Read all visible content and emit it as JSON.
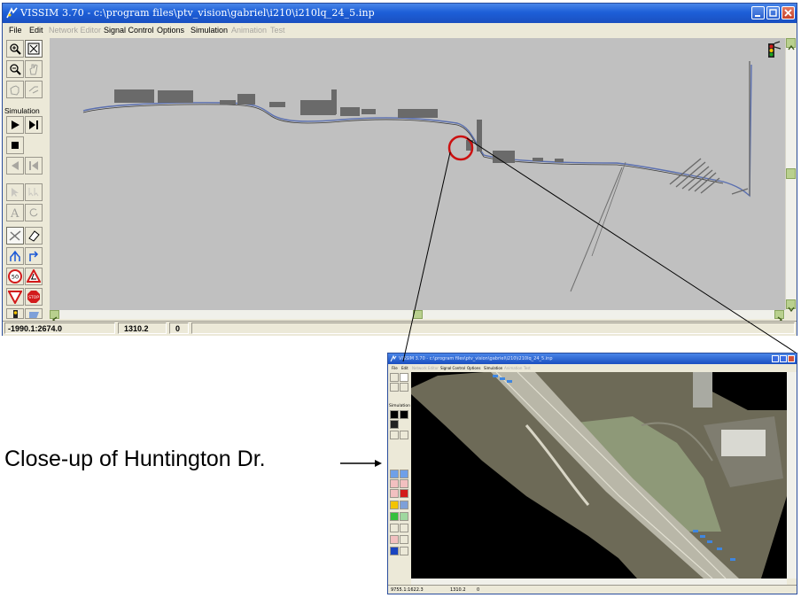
{
  "main_window": {
    "title": "VISSIM 3.70 - c:\\program files\\ptv_vision\\gabriel\\i210\\i210lq_24_5.inp",
    "menu": [
      {
        "label": "File",
        "enabled": true
      },
      {
        "label": "Edit",
        "enabled": true
      },
      {
        "label": "Network Editor",
        "enabled": false
      },
      {
        "label": "Signal Control",
        "enabled": true
      },
      {
        "label": "Options",
        "enabled": true
      },
      {
        "label": "Simulation",
        "enabled": true
      },
      {
        "label": "Animation",
        "enabled": false
      },
      {
        "label": "Test",
        "enabled": false
      }
    ],
    "toolbar": {
      "simulation_label": "Simulation",
      "speed_sign": "50",
      "stop_sign": "STOP"
    },
    "status": {
      "coordinates": "-1990.1:2674.0",
      "time": "1310.2",
      "count": "0"
    }
  },
  "closeup_window": {
    "title": "VISSIM 3.70 - c:\\program files\\ptv_vision\\gabriel\\i210\\i210lq_24_5.inp",
    "menu": [
      "File",
      "Edit",
      "Network Editor",
      "Signal Control",
      "Options",
      "Simulation",
      "Animation",
      "Test"
    ],
    "simulation_label": "Simulation",
    "status": {
      "coordinates": "9755.1:1622.3",
      "time": "1310.2",
      "count": "0"
    }
  },
  "annotation": {
    "caption": "Close-up of Huntington Dr.",
    "arrow": "→"
  },
  "colors": {
    "title_bar": "#1d5fd8",
    "canvas": "#c0c0c0",
    "highlight_circle": "#cc1111",
    "road_link": "#5a6fb0"
  }
}
